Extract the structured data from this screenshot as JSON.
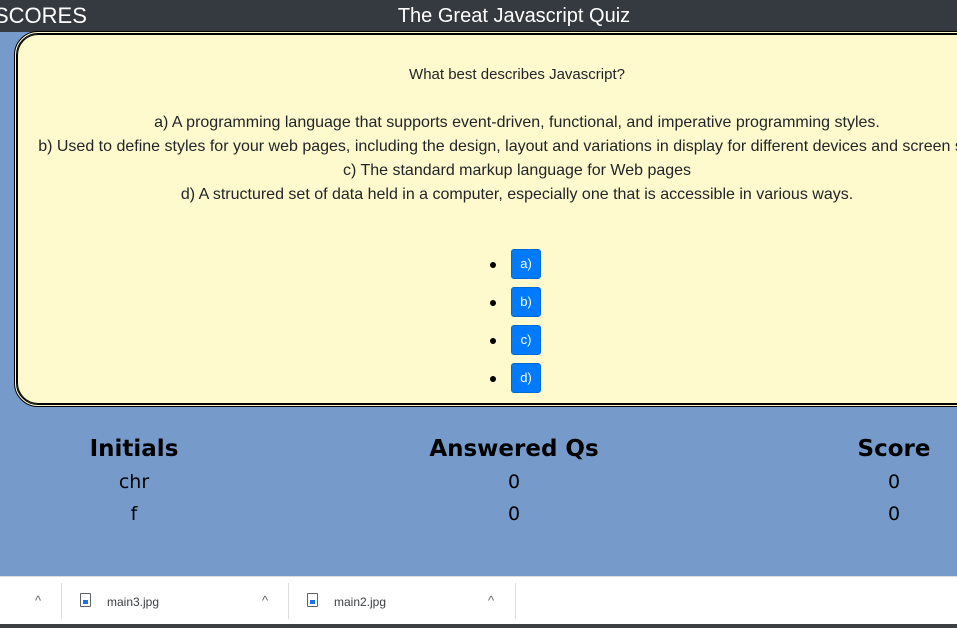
{
  "header": {
    "scores_link": "SCORES",
    "title": "The Great Javascript Quiz"
  },
  "quiz": {
    "question": "What best describes Javascript?",
    "options": [
      "a) A programming language that supports event-driven, functional, and imperative programming styles.",
      "b) Used to define styles for your web pages, including the design, layout and variations in display for different devices and screen sizes.",
      "c) The standard markup language for Web pages",
      "d) A structured set of data held in a computer, especially one that is accessible in various ways."
    ],
    "answer_buttons": [
      "a)",
      "b)",
      "c)",
      "d)"
    ]
  },
  "scores": {
    "headers": [
      "Initials",
      "Answered Qs",
      "Score"
    ],
    "rows": [
      {
        "initials": "chr",
        "answered": "0",
        "score": "0"
      },
      {
        "initials": "f",
        "answered": "0",
        "score": "0"
      }
    ]
  },
  "downloads": {
    "files": [
      "main3.jpg",
      "main2.jpg"
    ],
    "chevron": "^"
  },
  "colors": {
    "header_bg": "#343a40",
    "page_bg": "#769bcb",
    "card_bg": "#fffacd",
    "button_bg": "#007bff"
  }
}
